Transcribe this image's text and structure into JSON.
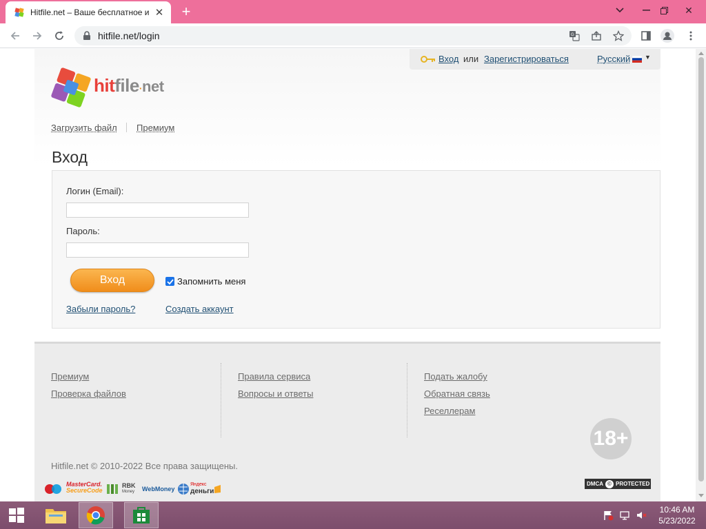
{
  "browser": {
    "tab_title": "Hitfile.net – Ваше бесплатное и",
    "url": "hitfile.net/login"
  },
  "colors": {
    "tabbar": "#ee6f9b",
    "accent_orange": "#f08d1b",
    "link_blue": "#1f4f73"
  },
  "page": {
    "topbar": {
      "login_link": "Вход",
      "or_text": "или",
      "register_link": "Зарегистрироваться",
      "language": "Русский"
    },
    "logo": {
      "part1": "hit",
      "part2": "file",
      "part3": "net"
    },
    "nav": {
      "upload": "Загрузить файл",
      "premium": "Премиум"
    },
    "title": "Вход",
    "form": {
      "login_label": "Логин (Email):",
      "login_value": "",
      "password_label": "Пароль:",
      "password_value": "",
      "submit": "Вход",
      "remember": "Запомнить меня",
      "remember_checked": true,
      "forgot": "Забыли пароль?",
      "create_account": "Создать аккаунт"
    },
    "footer": {
      "col1": [
        "Премиум",
        "Проверка файлов"
      ],
      "col2": [
        "Правила сервиса",
        "Вопросы и ответы"
      ],
      "col3": [
        "Подать жалобу",
        "Обратная связь",
        "Реселлерам"
      ],
      "age_badge": "18+",
      "copyright": "Hitfile.net © 2010-2022 Все права защищены.",
      "payments": {
        "mastercard1": "MasterCard.",
        "mastercard2": "SecureCode",
        "rbk1": "RBK",
        "rbk2": "Money",
        "webmoney": "WebMoney",
        "yandex1": "Яндекс",
        "yandex2": "деньги"
      },
      "dmca_1": "DMCA",
      "dmca_2": "PROTECTED"
    }
  },
  "taskbar": {
    "time": "10:46 AM",
    "date": "5/23/2022"
  }
}
